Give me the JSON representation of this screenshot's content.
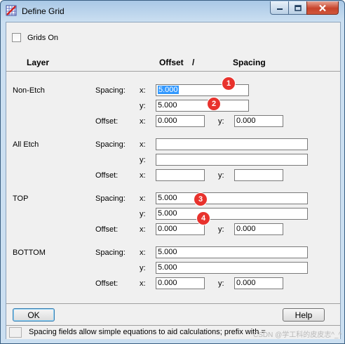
{
  "window": {
    "title": "Define Grid",
    "icon": "app-grid-icon",
    "controls": {
      "minimize": "minimize-icon",
      "maximize": "maximize-icon",
      "close": "close-icon"
    }
  },
  "grids_on": {
    "label": "Grids On",
    "checked": false
  },
  "headers": {
    "layer": "Layer",
    "offset": "Offset",
    "slash": "/",
    "spacing": "Spacing"
  },
  "labels": {
    "spacing": "Spacing:",
    "offset": "Offset:",
    "x": "x:",
    "y": "y:"
  },
  "layers": [
    {
      "name": "Non-Etch",
      "spacing_x": "5.000",
      "spacing_y": "5.000",
      "offset_x": "0.000",
      "offset_y": "0.000"
    },
    {
      "name": "All Etch",
      "spacing_x": "",
      "spacing_y": "",
      "offset_x": "",
      "offset_y": ""
    },
    {
      "name": "TOP",
      "spacing_x": "5.000",
      "spacing_y": "5.000",
      "offset_x": "0.000",
      "offset_y": "0.000"
    },
    {
      "name": "BOTTOM",
      "spacing_x": "5.000",
      "spacing_y": "5.000",
      "offset_x": "0.000",
      "offset_y": "0.000"
    }
  ],
  "markers": [
    "1",
    "2",
    "3",
    "4"
  ],
  "buttons": {
    "ok": "OK",
    "help": "Help"
  },
  "status": "Spacing fields allow simple equations to aid calculations; prefix with =",
  "watermark": "CSDN @学工科的皮皮志^_^",
  "colors": {
    "marker": "#e8322d",
    "selection": "#3399ff"
  }
}
